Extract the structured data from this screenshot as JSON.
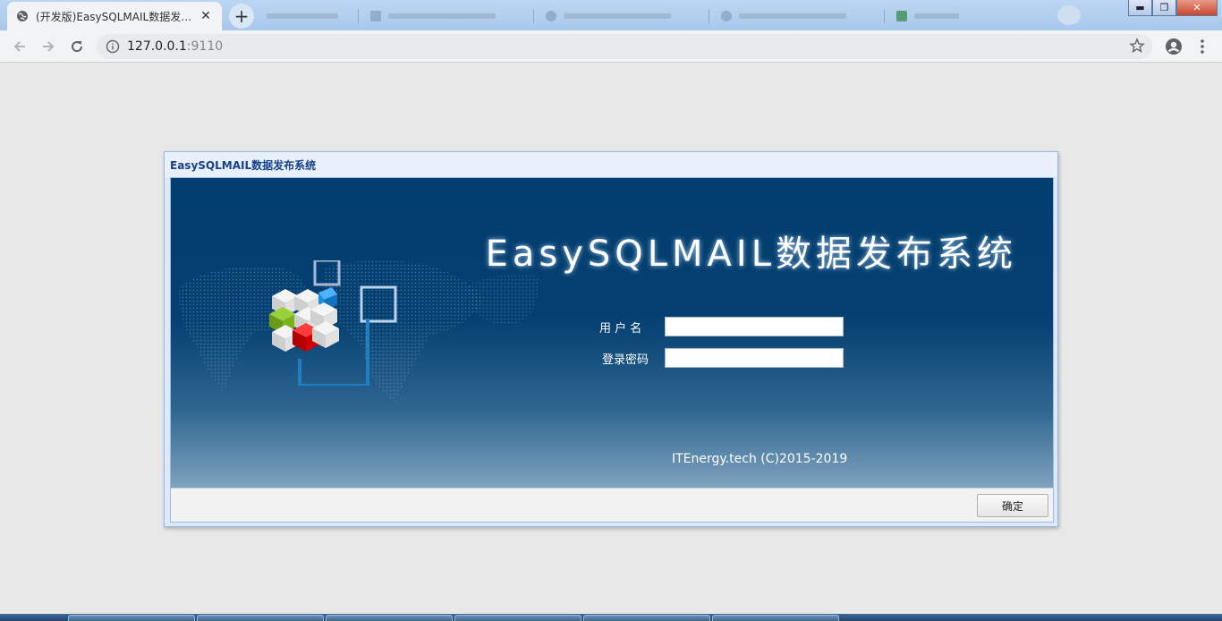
{
  "browser": {
    "active_tab": {
      "title": "(开发版)EasySQLMAIL数据发布系统",
      "favicon": "globe-icon",
      "close": "✕"
    },
    "new_tab_label": "+",
    "window_controls": {
      "minimize": "▬",
      "maximize": "❐",
      "close": "✕"
    },
    "address": {
      "host": "127.0.0.1",
      "port": ":9110",
      "info_icon": "info-icon"
    }
  },
  "login": {
    "window_title": "EasySQLMAIL数据发布系统",
    "banner_title": "EasySQLMAIL数据发布系统",
    "username_label": "用 户 名",
    "password_label": "登录密码",
    "username_value": "",
    "password_value": "",
    "copyright": "ITEnergy.tech  (C)2015-2019",
    "confirm_button": "确定"
  },
  "colors": {
    "banner_dark": "#023e6e",
    "banner_light": "#7fa2bd",
    "window_border": "#99bbe8",
    "window_title_text": "#15428b",
    "cube_green": "#7ab317",
    "cube_red": "#d00000",
    "cube_blue": "#1b8fe0"
  }
}
